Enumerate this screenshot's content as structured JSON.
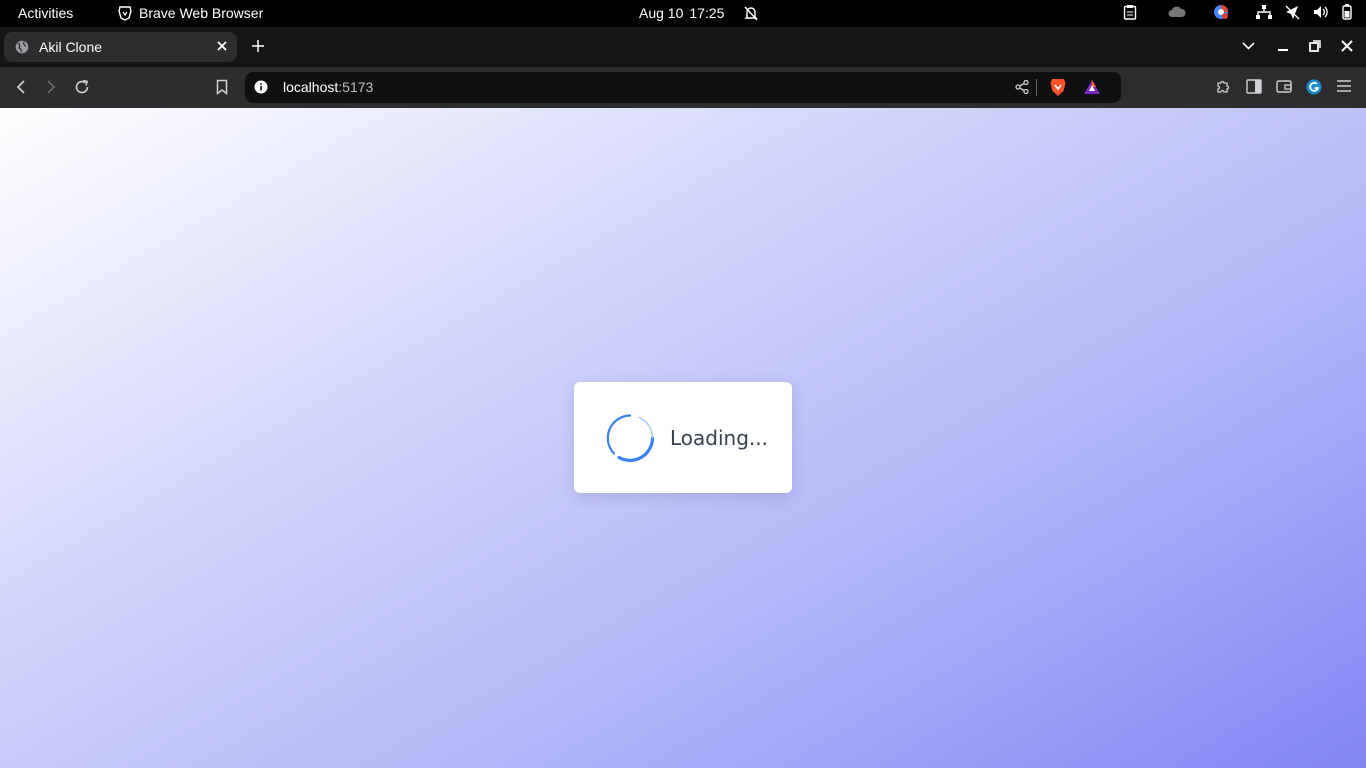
{
  "system_bar": {
    "activities": "Activities",
    "app_name": "Brave Web Browser",
    "date": "Aug 10",
    "time": "17:25"
  },
  "tab": {
    "title": "Akil Clone"
  },
  "address_bar": {
    "host": "localhost",
    "port": ":5173"
  },
  "page": {
    "loading_text": "Loading..."
  },
  "colors": {
    "spinner": "#3b82f6",
    "gradient_start": "#ffffff",
    "gradient_end": "#8186f5"
  }
}
